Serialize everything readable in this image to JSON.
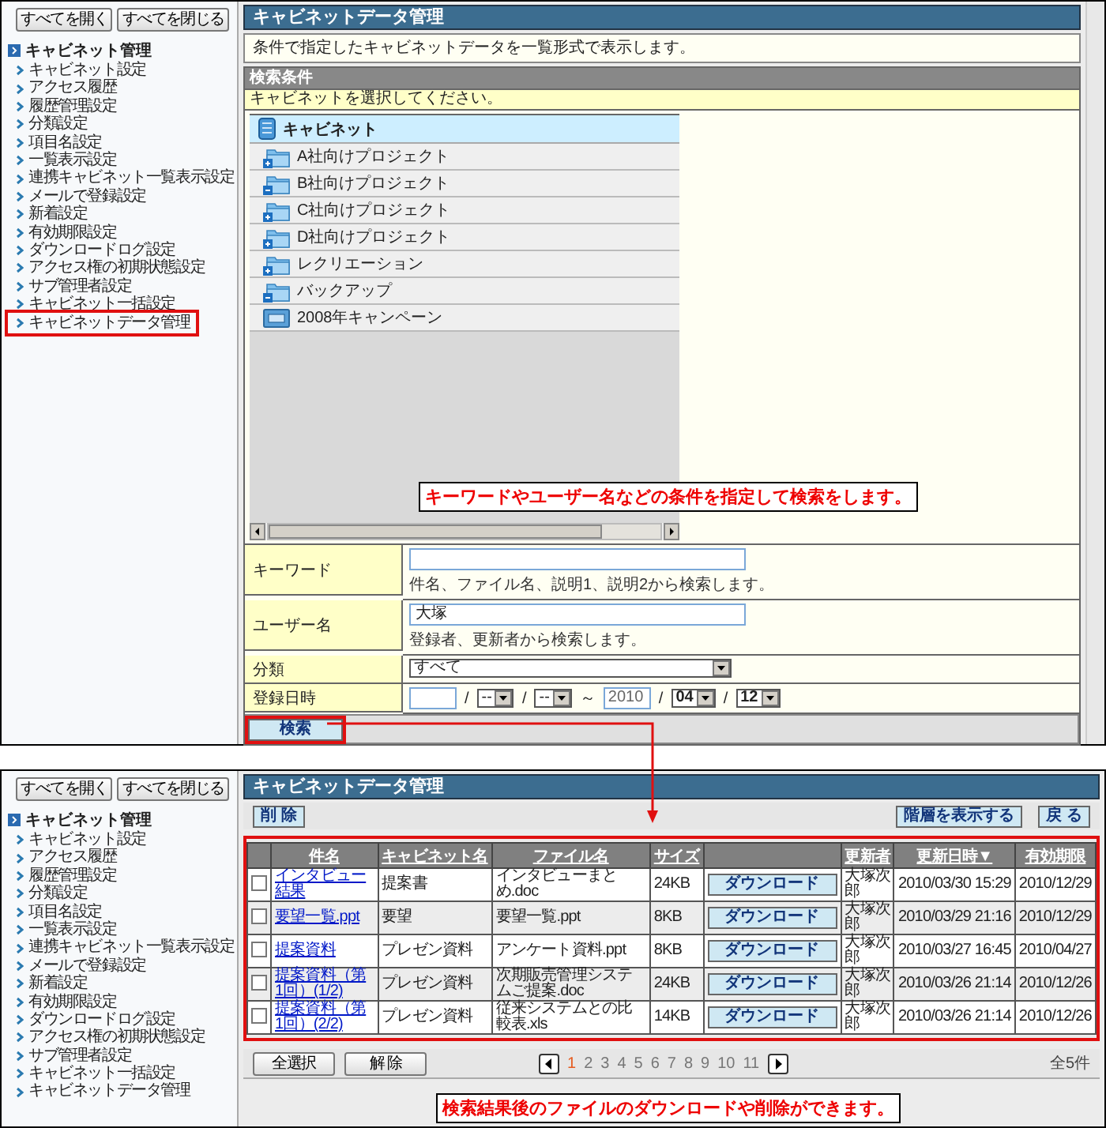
{
  "top_screen": {
    "sidebar": {
      "buttons": [
        "すべてを開く",
        "すべてを閉じる"
      ],
      "title": "キャビネット管理",
      "items": [
        {
          "label": "キャビネット設定",
          "highlighted": false
        },
        {
          "label": "アクセス履歴",
          "highlighted": false
        },
        {
          "label": "履歴管理設定",
          "highlighted": false
        },
        {
          "label": "分類設定",
          "highlighted": false
        },
        {
          "label": "項目名設定",
          "highlighted": false
        },
        {
          "label": "一覧表示設定",
          "highlighted": false
        },
        {
          "label": "連携キャビネット一覧表示設定",
          "highlighted": false
        },
        {
          "label": "メールで登録設定",
          "highlighted": false
        },
        {
          "label": "新着設定",
          "highlighted": false
        },
        {
          "label": "有効期限設定",
          "highlighted": false
        },
        {
          "label": "ダウンロードログ設定",
          "highlighted": false
        },
        {
          "label": "アクセス権の初期状態設定",
          "highlighted": false
        },
        {
          "label": "サブ管理者設定",
          "highlighted": false
        },
        {
          "label": "キャビネット一括設定",
          "highlighted": false
        },
        {
          "label": "キャビネットデータ管理",
          "highlighted": true
        }
      ]
    },
    "title": "キャビネットデータ管理",
    "description": "条件で指定したキャビネットデータを一覧形式で表示します。",
    "search_conditions": {
      "header": "検索条件",
      "notice": "キャビネットを選択してください。",
      "tree": {
        "root": "キャビネット",
        "children": [
          {
            "label": "A社向けプロジェクト",
            "kind": "plus"
          },
          {
            "label": "B社向けプロジェクト",
            "kind": "minus"
          },
          {
            "label": "C社向けプロジェクト",
            "kind": "plus"
          },
          {
            "label": "D社向けプロジェクト",
            "kind": "plus"
          },
          {
            "label": "レクリエーション",
            "kind": "plus"
          },
          {
            "label": "バックアップ",
            "kind": "minus"
          },
          {
            "label": "2008年キャンペーン",
            "kind": "drawer"
          }
        ]
      },
      "callout": "キーワードやユーザー名などの条件を指定して検索をします。",
      "form": [
        {
          "label": "キーワード",
          "kind": "text",
          "hint": "件名、ファイル名、説明1、説明2から検索します。"
        },
        {
          "label": "ユーザー名",
          "kind": "text",
          "value": "大塚",
          "hint": "登録者、更新者から検索します。"
        },
        {
          "label": "分類",
          "kind": "select",
          "value": "すべて"
        },
        {
          "label": "登録日時",
          "kind": "date",
          "parts": [
            {
              "kind": "input"
            },
            {
              "kind": "sep",
              "text": "/"
            },
            {
              "kind": "select",
              "value": "--"
            },
            {
              "kind": "sep",
              "text": "/"
            },
            {
              "kind": "select",
              "value": "--"
            },
            {
              "kind": "sep",
              "text": "～"
            },
            {
              "kind": "input",
              "value": "2010"
            },
            {
              "kind": "sep",
              "text": "/"
            },
            {
              "kind": "select",
              "value": "04"
            },
            {
              "kind": "sep",
              "text": "/"
            },
            {
              "kind": "select",
              "value": "12"
            }
          ]
        }
      ],
      "search_button": {
        "label": "検索",
        "highlighted": true
      }
    }
  },
  "bottom_screen": {
    "sidebar": {
      "buttons": [
        "すべてを開く",
        "すべてを閉じる"
      ],
      "title": "キャビネット管理",
      "items": [
        {
          "label": "キャビネット設定",
          "highlighted": false
        },
        {
          "label": "アクセス履歴",
          "highlighted": false
        },
        {
          "label": "履歴管理設定",
          "highlighted": false
        },
        {
          "label": "分類設定",
          "highlighted": false
        },
        {
          "label": "項目名設定",
          "highlighted": false
        },
        {
          "label": "一覧表示設定",
          "highlighted": false
        },
        {
          "label": "連携キャビネット一覧表示設定",
          "highlighted": false
        },
        {
          "label": "メールで登録設定",
          "highlighted": false
        },
        {
          "label": "新着設定",
          "highlighted": false
        },
        {
          "label": "有効期限設定",
          "highlighted": false
        },
        {
          "label": "ダウンロードログ設定",
          "highlighted": false
        },
        {
          "label": "アクセス権の初期状態設定",
          "highlighted": false
        },
        {
          "label": "サブ管理者設定",
          "highlighted": false
        },
        {
          "label": "キャビネット一括設定",
          "highlighted": false
        },
        {
          "label": "キャビネットデータ管理",
          "highlighted": false
        }
      ]
    },
    "title": "キャビネットデータ管理",
    "toolbar": {
      "delete": "削 除",
      "show_hierarchy": "階層を表示する",
      "back": "戻 る"
    },
    "table": {
      "columns": [
        "件名",
        "キャビネット名",
        "ファイル名",
        "サイズ",
        "更新者",
        "更新日時▼",
        "有効期限"
      ],
      "rows": [
        {
          "checked": false,
          "subject": "インタビュー結果",
          "cabinet": "提案書",
          "file": "インタビューまとめ.doc",
          "size": "24KB",
          "download": "ダウンロード",
          "updater": "大塚次郎",
          "updated": "2010/03/30 15:29",
          "expires": "2010/12/29"
        },
        {
          "checked": false,
          "subject": "要望一覧.ppt",
          "cabinet": "要望",
          "file": "要望一覧.ppt",
          "size": "8KB",
          "download": "ダウンロード",
          "updater": "大塚次郎",
          "updated": "2010/03/29 21:16",
          "expires": "2010/12/29"
        },
        {
          "checked": false,
          "subject": "提案資料",
          "cabinet": "プレゼン資料",
          "file": "アンケート資料.ppt",
          "size": "8KB",
          "download": "ダウンロード",
          "updater": "大塚次郎",
          "updated": "2010/03/27 16:45",
          "expires": "2010/04/27"
        },
        {
          "checked": false,
          "subject": "提案資料（第1回）(1/2)",
          "cabinet": "プレゼン資料",
          "file": "次期販売管理システムご提案.doc",
          "size": "24KB",
          "download": "ダウンロード",
          "updater": "大塚次郎",
          "updated": "2010/03/26 21:14",
          "expires": "2010/12/26"
        },
        {
          "checked": false,
          "subject": "提案資料（第1回）(2/2)",
          "cabinet": "プレゼン資料",
          "file": "従来システムとの比較表.xls",
          "size": "14KB",
          "download": "ダウンロード",
          "updater": "大塚次郎",
          "updated": "2010/03/26 21:14",
          "expires": "2010/12/26"
        }
      ]
    },
    "select_all": "全選択",
    "deselect": "解 除",
    "pagination": {
      "pages": [
        {
          "label": "1",
          "selected": true
        },
        {
          "label": "2",
          "selected": false
        },
        {
          "label": "3",
          "selected": false
        },
        {
          "label": "4",
          "selected": false
        },
        {
          "label": "5",
          "selected": false
        },
        {
          "label": "6",
          "selected": false
        },
        {
          "label": "7",
          "selected": false
        },
        {
          "label": "8",
          "selected": false
        },
        {
          "label": "9",
          "selected": false
        },
        {
          "label": "10",
          "selected": false
        },
        {
          "label": "11",
          "selected": false
        }
      ],
      "total": "全5件"
    },
    "callout": "検索結果後のファイルのダウンロードや削除ができます。"
  }
}
